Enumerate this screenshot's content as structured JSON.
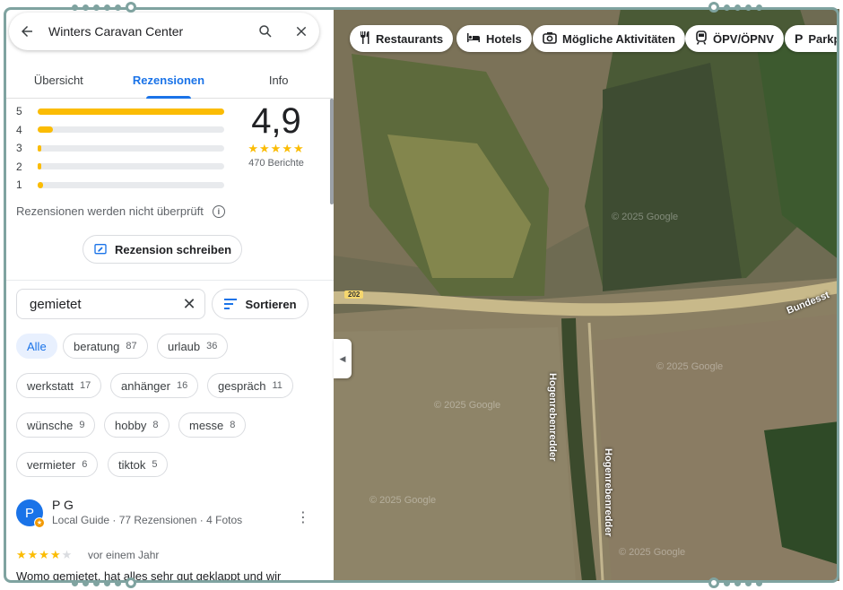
{
  "search": {
    "title": "Winters Caravan Center"
  },
  "tabs": [
    {
      "label": "Übersicht"
    },
    {
      "label": "Rezensionen"
    },
    {
      "label": "Info"
    }
  ],
  "rating": {
    "score": "4,9",
    "stars": "★★★★★",
    "count_label": "470 Berichte",
    "histogram": [
      {
        "stars": "5",
        "fraction": 1.0
      },
      {
        "stars": "4",
        "fraction": 0.08
      },
      {
        "stars": "3",
        "fraction": 0.01
      },
      {
        "stars": "2",
        "fraction": 0.01
      },
      {
        "stars": "1",
        "fraction": 0.03
      }
    ]
  },
  "note": "Rezensionen werden nicht überprüft",
  "write_review_label": "Rezension schreiben",
  "filter": {
    "value": "gemietet",
    "sort_label": "Sortieren"
  },
  "chips": [
    {
      "label": "Alle",
      "count": ""
    },
    {
      "label": "beratung",
      "count": "87"
    },
    {
      "label": "urlaub",
      "count": "36"
    },
    {
      "label": "werkstatt",
      "count": "17"
    },
    {
      "label": "anhänger",
      "count": "16"
    },
    {
      "label": "gespräch",
      "count": "11"
    },
    {
      "label": "wünsche",
      "count": "9"
    },
    {
      "label": "hobby",
      "count": "8"
    },
    {
      "label": "messe",
      "count": "8"
    },
    {
      "label": "vermieter",
      "count": "6"
    },
    {
      "label": "tiktok",
      "count": "5"
    }
  ],
  "review": {
    "avatar_letter": "P",
    "name": "P G",
    "meta": "Local Guide · 77 Rezensionen · 4 Fotos",
    "stars_on": "★★★★",
    "stars_off": "★",
    "rating": 4,
    "date": "vor einem Jahr",
    "text": "Womo gemietet, hat alles sehr gut geklappt und wir"
  },
  "map": {
    "chips": [
      {
        "label": "Restaurants",
        "icon": "restaurant-icon"
      },
      {
        "label": "Hotels",
        "icon": "hotel-icon"
      },
      {
        "label": "Mögliche Aktivitäten",
        "icon": "camera-icon"
      },
      {
        "label": "ÖPV/ÖPNV",
        "icon": "train-icon"
      },
      {
        "label": "Parkp",
        "icon": "parking-icon"
      }
    ],
    "road_shield": "202",
    "road_name": "Bundesst",
    "street1": "Hogenrebenredder",
    "street2": "Hogenrebenredder",
    "watermark": "© 2025 Google"
  }
}
